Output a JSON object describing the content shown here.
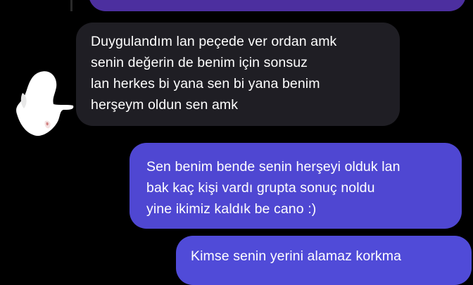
{
  "conversation": {
    "colors": {
      "background": "#000000",
      "incoming_bubble": "#1f1e24",
      "outgoing_bubble": "#4f47d2",
      "outgoing_bubble_top": "#4c2f9f",
      "text": "#ffffff"
    },
    "incoming": {
      "avatar_icon": "user-avatar-icon (obscured)",
      "lines": [
        "Duygulandım lan peçede ver ordan amk",
        "senin değerin de benim için sonsuz",
        "lan herkes bi yana sen bi yana benim",
        "herşeym oldun sen amk"
      ]
    },
    "outgoing_middle": {
      "lines": [
        "Sen benim bende senin herşeyi olduk lan",
        "bak kaç kişi vardı grupta sonuç noldu",
        "yine ikimiz kaldık be cano :)"
      ]
    },
    "outgoing_bottom": {
      "lines": [
        "Kimse senin yerini alamaz korkma"
      ]
    }
  }
}
